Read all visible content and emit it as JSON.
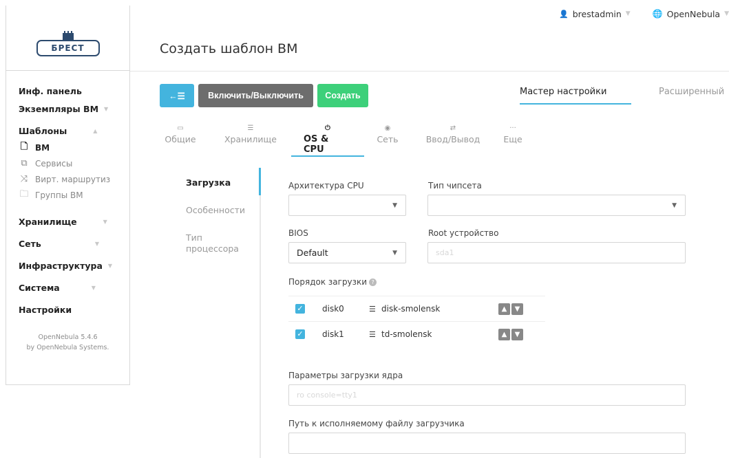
{
  "logo": {
    "text": "БРЕСТ"
  },
  "top": {
    "user": "brestadmin",
    "zone": "OpenNebula"
  },
  "page": {
    "title": "Создать шаблон ВМ"
  },
  "sidebar": {
    "items": [
      {
        "label": "Инф. панель"
      },
      {
        "label": "Экземпляры ВМ"
      },
      {
        "label": "Шаблоны"
      },
      {
        "label": "Хранилище"
      },
      {
        "label": "Сеть"
      },
      {
        "label": "Инфраструктура"
      },
      {
        "label": "Система"
      },
      {
        "label": "Настройки"
      }
    ],
    "subitems": [
      {
        "label": "ВМ"
      },
      {
        "label": "Сервисы"
      },
      {
        "label": "Вирт. маршрутиз"
      },
      {
        "label": "Группы ВМ"
      }
    ],
    "version": "OpenNebula 5.4.6",
    "company": "by OpenNebula Systems."
  },
  "actions": {
    "back": "←☰",
    "toggle": "Включить/Выключить",
    "create": "Создать"
  },
  "modes": {
    "wizard": "Мастер настройки",
    "advanced": "Расширенный"
  },
  "tabs": [
    {
      "label": "Общие",
      "icon": "▭"
    },
    {
      "label": "Хранилище",
      "icon": "☰"
    },
    {
      "label": "OS & CPU",
      "icon": "⏻"
    },
    {
      "label": "Сеть",
      "icon": "◉"
    },
    {
      "label": "Ввод/Вывод",
      "icon": "⇄"
    },
    {
      "label": "Еще",
      "icon": "···"
    }
  ],
  "vtabs": [
    {
      "label": "Загрузка"
    },
    {
      "label": "Особенности"
    },
    {
      "label": "Тип процессора"
    }
  ],
  "form": {
    "cpu_arch_label": "Архитектура CPU",
    "cpu_arch_value": "",
    "chipset_label": "Тип чипсета",
    "chipset_value": "",
    "bios_label": "BIOS",
    "bios_value": "Default",
    "root_label": "Root устройство",
    "root_placeholder": "sda1",
    "boot_order_label": "Порядок загрузки",
    "kernel_params_label": "Параметры загрузки ядра",
    "kernel_params_placeholder": "ro console=tty1",
    "bootloader_label": "Путь к исполняемому файлу загрузчика",
    "bootloader_value": ""
  },
  "boot": [
    {
      "name": "disk0",
      "disk": "disk-smolensk",
      "checked": true
    },
    {
      "name": "disk1",
      "disk": "td-smolensk",
      "checked": true
    }
  ],
  "colors": {
    "accent": "#43b4de",
    "create": "#3dd07a",
    "toggle": "#6d6d6d"
  }
}
